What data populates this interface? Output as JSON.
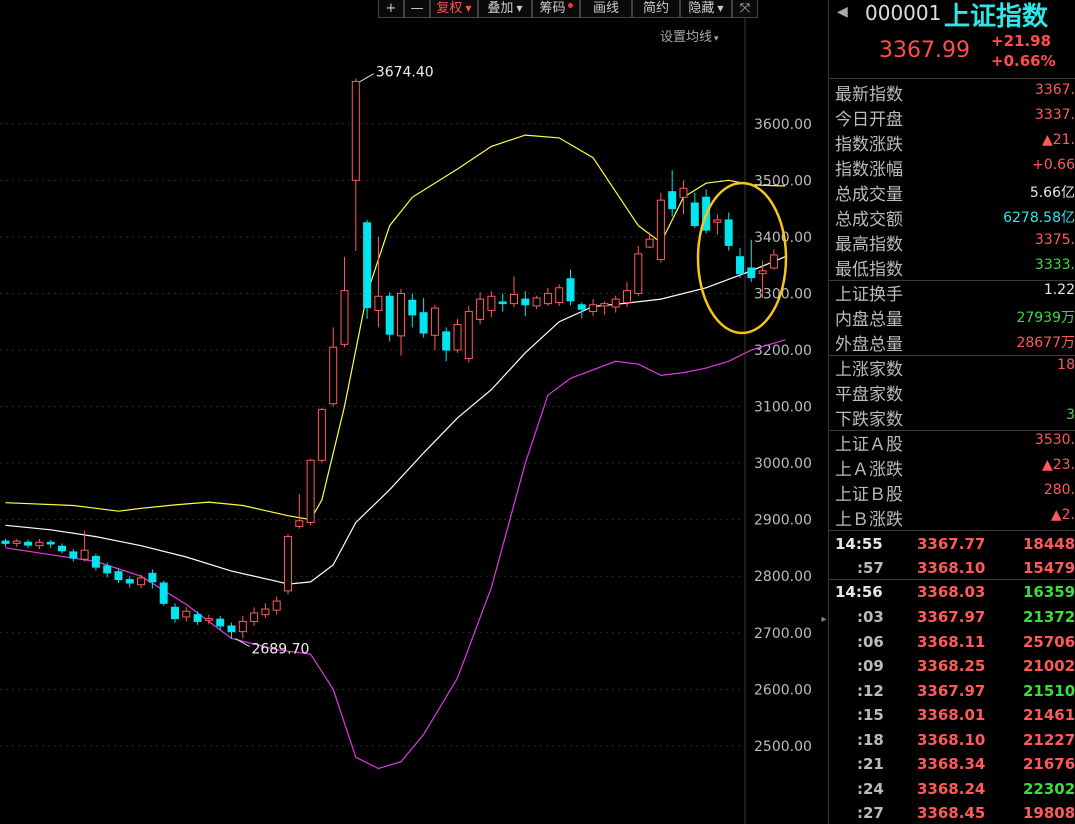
{
  "toolbar": {
    "items": [
      {
        "label": "+",
        "active": false,
        "caret": false,
        "dot": false
      },
      {
        "label": "—",
        "active": false,
        "caret": false,
        "dot": false
      },
      {
        "label": "复权",
        "active": true,
        "caret": true,
        "dot": false
      },
      {
        "label": "叠加",
        "active": false,
        "caret": true,
        "dot": false
      },
      {
        "label": "筹码",
        "active": false,
        "caret": false,
        "dot": true
      },
      {
        "label": "画线",
        "active": false,
        "caret": false,
        "dot": false
      },
      {
        "label": "简约",
        "active": false,
        "caret": false,
        "dot": false
      },
      {
        "label": "隐藏",
        "active": false,
        "caret": true,
        "dot": false
      },
      {
        "label": "⤧",
        "active": false,
        "caret": false,
        "dot": false
      }
    ],
    "ma_setting": "设置均线"
  },
  "chart_data": {
    "type": "candlestick",
    "ylim": [
      2440,
      3700
    ],
    "yticks": [
      "3600.00",
      "3500.00",
      "3400.00",
      "3300.00",
      "3200.00",
      "3100.00",
      "3000.00",
      "2900.00",
      "2800.00",
      "2700.00",
      "2600.00",
      "2500.00"
    ],
    "ytick_values": [
      3600,
      3500,
      3400,
      3300,
      3200,
      3100,
      3000,
      2900,
      2800,
      2700,
      2600,
      2500
    ],
    "annotations": [
      {
        "text": "3674.40",
        "value": 3674.4
      },
      {
        "text": "2689.70",
        "value": 2689.7
      }
    ],
    "candles": [
      [
        2862,
        2858,
        2866,
        2852
      ],
      [
        2858,
        2862,
        2866,
        2852
      ],
      [
        2860,
        2855,
        2865,
        2850
      ],
      [
        2854,
        2860,
        2866,
        2848
      ],
      [
        2860,
        2857,
        2864,
        2850
      ],
      [
        2853,
        2845,
        2858,
        2840
      ],
      [
        2843,
        2832,
        2848,
        2826
      ],
      [
        2830,
        2846,
        2880,
        2826
      ],
      [
        2835,
        2816,
        2840,
        2810
      ],
      [
        2818,
        2806,
        2824,
        2798
      ],
      [
        2808,
        2794,
        2814,
        2788
      ],
      [
        2794,
        2788,
        2800,
        2780
      ],
      [
        2785,
        2797,
        2803,
        2779
      ],
      [
        2805,
        2790,
        2812,
        2778
      ],
      [
        2788,
        2752,
        2792,
        2748
      ],
      [
        2745,
        2725,
        2752,
        2718
      ],
      [
        2728,
        2738,
        2745,
        2720
      ],
      [
        2732,
        2720,
        2738,
        2714
      ],
      [
        2722,
        2725,
        2732,
        2715
      ],
      [
        2724,
        2712,
        2730,
        2705
      ],
      [
        2712,
        2702,
        2718,
        2690
      ],
      [
        2702,
        2720,
        2730,
        2690
      ],
      [
        2720,
        2735,
        2745,
        2712
      ],
      [
        2732,
        2742,
        2752,
        2726
      ],
      [
        2740,
        2756,
        2764,
        2732
      ],
      [
        2774,
        2870,
        2874,
        2768
      ],
      [
        2888,
        2898,
        2945,
        2884
      ],
      [
        2895,
        3005,
        3008,
        2890
      ],
      [
        3005,
        3095,
        3098,
        3000
      ],
      [
        3105,
        3205,
        3240,
        3100
      ],
      [
        3210,
        3305,
        3365,
        3205
      ],
      [
        3500,
        3675,
        3680,
        3375
      ],
      [
        3425,
        3275,
        3430,
        3255
      ],
      [
        3270,
        3295,
        3400,
        3240
      ],
      [
        3295,
        3228,
        3302,
        3215
      ],
      [
        3225,
        3300,
        3308,
        3190
      ],
      [
        3288,
        3262,
        3300,
        3240
      ],
      [
        3266,
        3230,
        3292,
        3222
      ],
      [
        3226,
        3274,
        3280,
        3200
      ],
      [
        3232,
        3200,
        3240,
        3180
      ],
      [
        3200,
        3245,
        3255,
        3195
      ],
      [
        3185,
        3268,
        3278,
        3178
      ],
      [
        3254,
        3290,
        3302,
        3245
      ],
      [
        3270,
        3295,
        3304,
        3258
      ],
      [
        3285,
        3282,
        3300,
        3268
      ],
      [
        3282,
        3298,
        3330,
        3276
      ],
      [
        3290,
        3280,
        3304,
        3260
      ],
      [
        3278,
        3292,
        3296,
        3272
      ],
      [
        3282,
        3300,
        3310,
        3278
      ],
      [
        3284,
        3310,
        3316,
        3278
      ],
      [
        3326,
        3287,
        3342,
        3279
      ],
      [
        3280,
        3272,
        3284,
        3256
      ],
      [
        3268,
        3280,
        3290,
        3260
      ],
      [
        3278,
        3282,
        3286,
        3262
      ],
      [
        3276,
        3290,
        3296,
        3266
      ],
      [
        3284,
        3305,
        3320,
        3276
      ],
      [
        3300,
        3370,
        3384,
        3295
      ],
      [
        3382,
        3396,
        3408,
        3380
      ],
      [
        3360,
        3465,
        3478,
        3355
      ],
      [
        3480,
        3450,
        3518,
        3436
      ],
      [
        3470,
        3486,
        3500,
        3440
      ],
      [
        3460,
        3420,
        3478,
        3416
      ],
      [
        3470,
        3412,
        3484,
        3406
      ],
      [
        3426,
        3430,
        3440,
        3404
      ],
      [
        3430,
        3385,
        3443,
        3376
      ],
      [
        3365,
        3335,
        3380,
        3328
      ],
      [
        3345,
        3328,
        3395,
        3320
      ],
      [
        3335,
        3340,
        3358,
        3292
      ],
      [
        3345,
        3368,
        3378,
        3342
      ]
    ],
    "bands": {
      "upper": [
        [
          0,
          2930
        ],
        [
          6,
          2925
        ],
        [
          8,
          2920
        ],
        [
          10,
          2915
        ],
        [
          12,
          2920
        ],
        [
          15,
          2926
        ],
        [
          18,
          2931
        ],
        [
          21,
          2925
        ],
        [
          25,
          2907
        ],
        [
          27,
          2900
        ],
        [
          28,
          2935
        ],
        [
          30,
          3100
        ],
        [
          32,
          3300
        ],
        [
          34,
          3420
        ],
        [
          36,
          3470
        ],
        [
          40,
          3520
        ],
        [
          43,
          3560
        ],
        [
          46,
          3580
        ],
        [
          49,
          3575
        ],
        [
          52,
          3540
        ],
        [
          54,
          3480
        ],
        [
          56,
          3420
        ],
        [
          58,
          3390
        ],
        [
          60,
          3470
        ],
        [
          62,
          3495
        ],
        [
          64,
          3500
        ],
        [
          66,
          3492
        ],
        [
          69,
          3490
        ]
      ],
      "middle": [
        [
          0,
          2890
        ],
        [
          4,
          2882
        ],
        [
          8,
          2870
        ],
        [
          12,
          2854
        ],
        [
          16,
          2834
        ],
        [
          20,
          2809
        ],
        [
          24,
          2791
        ],
        [
          25,
          2786
        ],
        [
          27,
          2790
        ],
        [
          29,
          2820
        ],
        [
          31,
          2895
        ],
        [
          34,
          2953
        ],
        [
          37,
          3018
        ],
        [
          40,
          3080
        ],
        [
          43,
          3130
        ],
        [
          46,
          3195
        ],
        [
          49,
          3250
        ],
        [
          52,
          3277
        ],
        [
          55,
          3283
        ],
        [
          58,
          3290
        ],
        [
          62,
          3310
        ],
        [
          66,
          3340
        ],
        [
          69,
          3365
        ]
      ],
      "lower": [
        [
          0,
          2850
        ],
        [
          4,
          2838
        ],
        [
          8,
          2826
        ],
        [
          12,
          2800
        ],
        [
          16,
          2750
        ],
        [
          20,
          2690
        ],
        [
          24,
          2670
        ],
        [
          27,
          2662
        ],
        [
          29,
          2600
        ],
        [
          31,
          2480
        ],
        [
          33,
          2460
        ],
        [
          35,
          2472
        ],
        [
          37,
          2520
        ],
        [
          40,
          2620
        ],
        [
          43,
          2780
        ],
        [
          46,
          3000
        ],
        [
          48,
          3120
        ],
        [
          50,
          3150
        ],
        [
          52,
          3165
        ],
        [
          54,
          3180
        ],
        [
          56,
          3175
        ],
        [
          58,
          3155
        ],
        [
          60,
          3160
        ],
        [
          62,
          3168
        ],
        [
          64,
          3180
        ],
        [
          66,
          3200
        ],
        [
          69,
          3218
        ]
      ]
    }
  },
  "sidebar": {
    "code": "000001",
    "name": "上证指数",
    "price": "3367.99",
    "change": "+21.98",
    "change_pct": "+0.66%",
    "stats": [
      {
        "label": "最新指数",
        "value": "3367.",
        "color": "#ff5a5a"
      },
      {
        "label": "今日开盘",
        "value": "3337.",
        "color": "#ff5a5a"
      },
      {
        "label": "指数涨跌",
        "value": "▲21.",
        "color": "#ff5a5a"
      },
      {
        "label": "指数涨幅",
        "value": "+0.66",
        "color": "#ff5a5a"
      },
      {
        "label": "总成交量",
        "value": "5.66亿",
        "color": "#e6e6e6"
      },
      {
        "label": "总成交额",
        "value": "6278.58亿",
        "color": "#2ee6e6"
      },
      {
        "label": "最高指数",
        "value": "3375.",
        "color": "#ff5a5a"
      },
      {
        "label": "最低指数",
        "value": "3333.",
        "color": "#3ddc3d"
      },
      {
        "label": "上证换手",
        "value": "1.22",
        "color": "#e6e6e6"
      },
      {
        "label": "内盘总量",
        "value": "27939万",
        "color": "#3ddc3d"
      },
      {
        "label": "外盘总量",
        "value": "28677万",
        "color": "#ff5a5a"
      },
      {
        "label": "上涨家数",
        "value": "18",
        "color": "#ff5a5a"
      },
      {
        "label": "平盘家数",
        "value": "",
        "color": "#e6e6e6"
      },
      {
        "label": "下跌家数",
        "value": "3",
        "color": "#3ddc3d"
      },
      {
        "label": "上证Ａ股",
        "value": "3530.",
        "color": "#ff5a5a"
      },
      {
        "label": "上Ａ涨跌",
        "value": "▲23.",
        "color": "#ff5a5a"
      },
      {
        "label": "上证Ｂ股",
        "value": "280.",
        "color": "#ff5a5a"
      },
      {
        "label": "上Ｂ涨跌",
        "value": "▲2.",
        "color": "#ff5a5a"
      }
    ],
    "ticks": [
      {
        "time": "14:55",
        "price": "3367.77",
        "vol": "18448",
        "vol_color": "#ff5a5a",
        "major": true
      },
      {
        "time": ":57",
        "price": "3368.10",
        "vol": "15479",
        "vol_color": "#ff5a5a",
        "major": false
      },
      {
        "time": "14:56",
        "price": "3368.03",
        "vol": "16359",
        "vol_color": "#3ddc3d",
        "major": true
      },
      {
        "time": ":03",
        "price": "3367.97",
        "vol": "21372",
        "vol_color": "#3ddc3d",
        "major": false
      },
      {
        "time": ":06",
        "price": "3368.11",
        "vol": "25706",
        "vol_color": "#ff5a5a",
        "major": false
      },
      {
        "time": ":09",
        "price": "3368.25",
        "vol": "21002",
        "vol_color": "#ff5a5a",
        "major": false
      },
      {
        "time": ":12",
        "price": "3367.97",
        "vol": "21510",
        "vol_color": "#3ddc3d",
        "major": false
      },
      {
        "time": ":15",
        "price": "3368.01",
        "vol": "21461",
        "vol_color": "#ff5a5a",
        "major": false
      },
      {
        "time": ":18",
        "price": "3368.10",
        "vol": "21227",
        "vol_color": "#ff5a5a",
        "major": false
      },
      {
        "time": ":21",
        "price": "3368.34",
        "vol": "21676",
        "vol_color": "#ff5a5a",
        "major": false
      },
      {
        "time": ":24",
        "price": "3368.24",
        "vol": "22302",
        "vol_color": "#3ddc3d",
        "major": false
      },
      {
        "time": ":27",
        "price": "3368.45",
        "vol": "19808",
        "vol_color": "#ff5a5a",
        "major": false
      }
    ]
  },
  "colors": {
    "up": "#ff5a5a",
    "down": "#00e5ee",
    "upper_band": "#ffff40",
    "middle_band": "#ffffff",
    "lower_band": "#e03ae0",
    "highlight": "#f5c518",
    "grid": "#2a2a2a"
  }
}
